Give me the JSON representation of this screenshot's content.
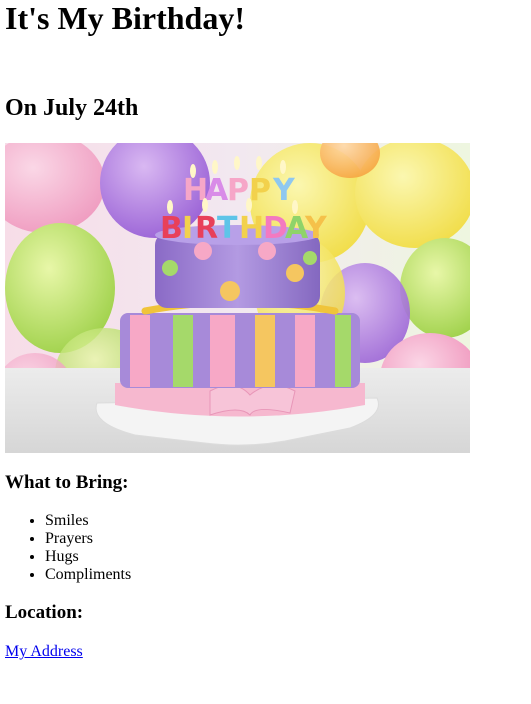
{
  "page": {
    "title": "It's My Birthday!",
    "date_heading": "On July 24th",
    "image": {
      "description_icon": "birthday-cake-photo",
      "cake_topper_word_1": "HAPPY",
      "cake_topper_word_2": "BIRTHDAY"
    },
    "what_to_bring": {
      "heading": "What to Bring:",
      "items": [
        "Smiles",
        "Prayers",
        "Hugs",
        "Compliments"
      ]
    },
    "location": {
      "heading": "Location:",
      "link_text": "My Address"
    }
  },
  "colors": {
    "link": "#0000ee",
    "text": "#000000",
    "background": "#ffffff"
  }
}
